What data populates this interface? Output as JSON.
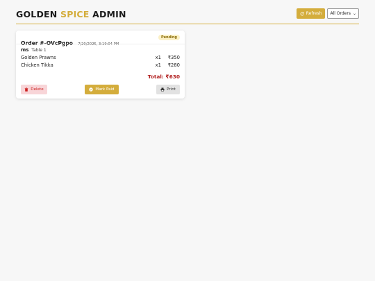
{
  "app": {
    "brand_part1": "GOLDEN",
    "brand_part2": "SPICE",
    "brand_part3": "ADMIN"
  },
  "toolbar": {
    "refresh_label": "Refresh",
    "filter_value": "All Orders"
  },
  "colors": {
    "accent": "#d4ad3c",
    "total": "#b11f1f",
    "delete_bg": "#f8d5d8",
    "pending_bg": "#fbf0c5"
  },
  "order": {
    "id": "Order #-OVcPgpo",
    "time": "7/20/2025, 3:19:04 PM",
    "status": "Pending",
    "customer": "ms",
    "table": "Table 1",
    "items": [
      {
        "name": "Golden Prawns",
        "qty": "x1",
        "price": "₹350"
      },
      {
        "name": "Chicken Tikka",
        "qty": "x1",
        "price": "₹280"
      }
    ],
    "total": "Total: ₹630",
    "delete_label": "Delete",
    "mark_paid_label": "Mark Paid",
    "print_label": "Print"
  },
  "icons": {
    "refresh": "refresh-icon",
    "delete": "trash-icon",
    "mark_paid": "check-circle-icon",
    "print": "printer-icon"
  }
}
